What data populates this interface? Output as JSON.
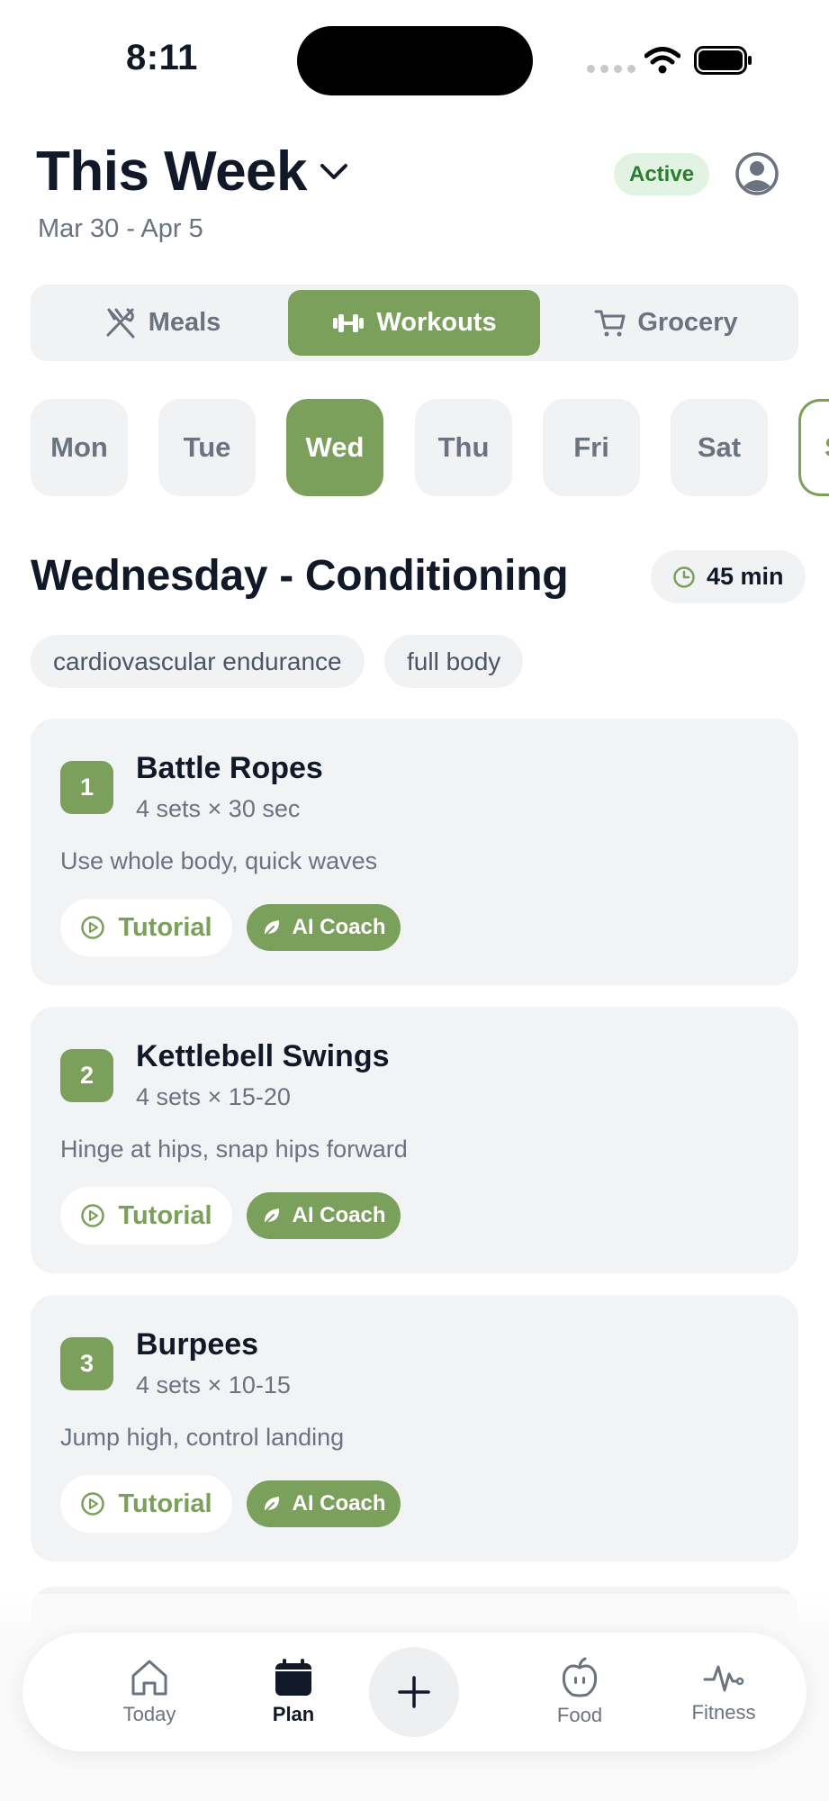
{
  "status_bar": {
    "time": "8:11"
  },
  "header": {
    "title": "This Week",
    "date_range": "Mar 30 - Apr 5",
    "status_badge": "Active"
  },
  "segments": [
    {
      "label": "Meals",
      "icon": "utensils-icon",
      "active": false
    },
    {
      "label": "Workouts",
      "icon": "dumbbell-icon",
      "active": true
    },
    {
      "label": "Grocery",
      "icon": "cart-icon",
      "active": false
    }
  ],
  "days": [
    {
      "label": "Mon"
    },
    {
      "label": "Tue"
    },
    {
      "label": "Wed",
      "active": true
    },
    {
      "label": "Thu"
    },
    {
      "label": "Fri"
    },
    {
      "label": "Sat"
    },
    {
      "label": "S"
    }
  ],
  "workout": {
    "title": "Wednesday - Conditioning",
    "duration": "45 min",
    "tags": [
      "cardiovascular endurance",
      "full body"
    ],
    "exercises": [
      {
        "number": "1",
        "name": "Battle Ropes",
        "sets": "4 sets × 30 sec",
        "note": "Use whole body, quick waves"
      },
      {
        "number": "2",
        "name": "Kettlebell Swings",
        "sets": "4 sets × 15-20",
        "note": "Hinge at hips, snap hips forward"
      },
      {
        "number": "3",
        "name": "Burpees",
        "sets": "4 sets × 10-15",
        "note": "Jump high, control landing"
      }
    ],
    "tutorial_label": "Tutorial",
    "ai_coach_label": "AI Coach"
  },
  "tabbar": [
    {
      "label": "Today",
      "icon": "home-icon"
    },
    {
      "label": "Plan",
      "icon": "calendar-icon",
      "active": true
    },
    {
      "label": "Food",
      "icon": "apple-icon"
    },
    {
      "label": "Fitness",
      "icon": "pulse-icon"
    }
  ],
  "colors": {
    "accent": "#7ba05b",
    "badge_bg": "#e3f3e3",
    "badge_text": "#2e7d32"
  }
}
